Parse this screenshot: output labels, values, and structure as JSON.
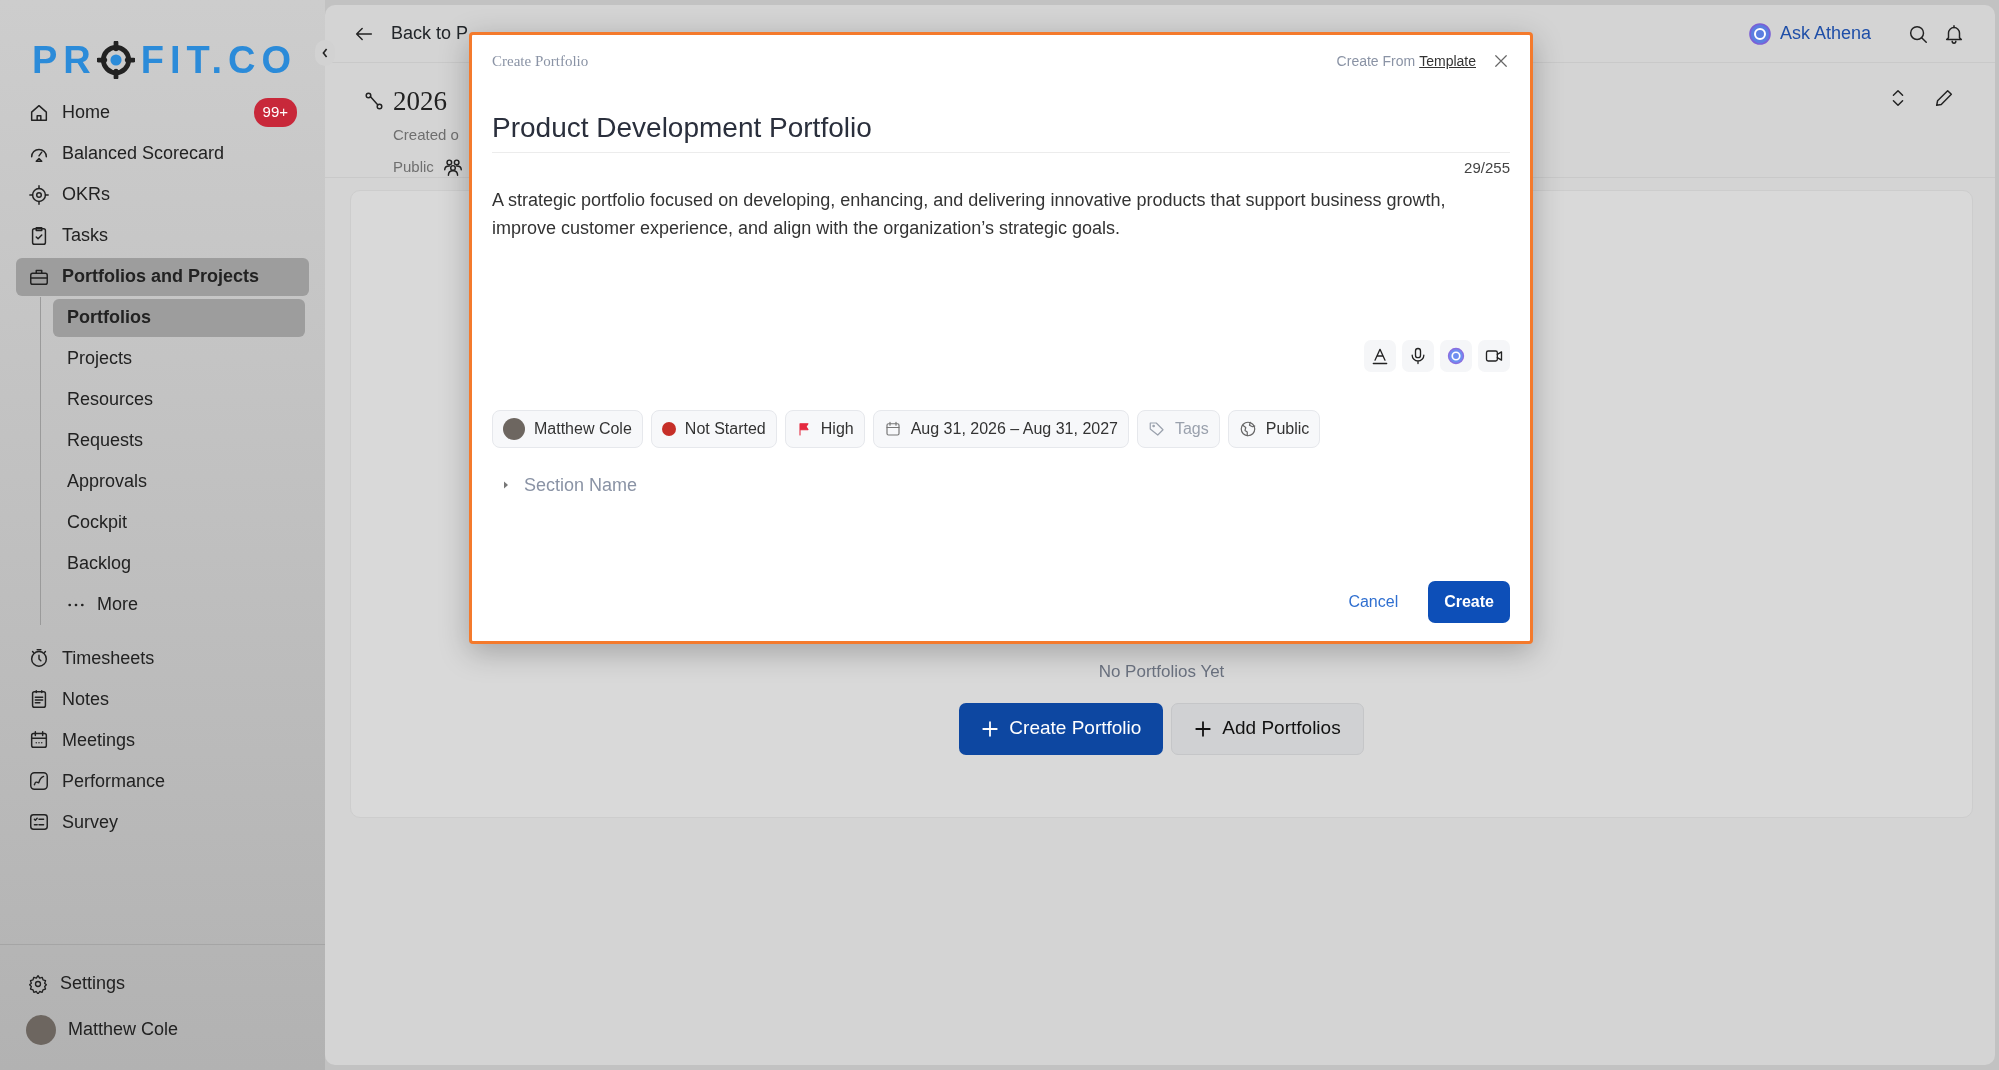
{
  "logo": {
    "before": "PR",
    "after": "FIT.CO"
  },
  "sidebar": {
    "items": [
      {
        "label": "Home",
        "badge": "99+",
        "selected": false
      },
      {
        "label": "Balanced Scorecard",
        "selected": false
      },
      {
        "label": "OKRs",
        "selected": false
      },
      {
        "label": "Tasks",
        "selected": false
      },
      {
        "label": "Portfolios and Projects",
        "selected": true,
        "children": [
          {
            "label": "Portfolios",
            "selected": true
          },
          {
            "label": "Projects",
            "selected": false
          },
          {
            "label": "Resources",
            "selected": false
          },
          {
            "label": "Requests",
            "selected": false
          },
          {
            "label": "Approvals",
            "selected": false
          },
          {
            "label": "Cockpit",
            "selected": false
          },
          {
            "label": "Backlog",
            "selected": false
          },
          {
            "label": "More",
            "kind": "more",
            "selected": false
          }
        ]
      },
      {
        "label": "Timesheets",
        "selected": false
      },
      {
        "label": "Notes",
        "selected": false
      },
      {
        "label": "Meetings",
        "selected": false
      },
      {
        "label": "Performance",
        "selected": false
      },
      {
        "label": "Survey",
        "selected": false
      }
    ],
    "settings": "Settings",
    "user": "Matthew Cole"
  },
  "topbar": {
    "back": "Back to P",
    "assistant": "Ask Athena"
  },
  "page": {
    "title": "2026",
    "meta": "Created o",
    "visibility": "Public"
  },
  "empty_state": {
    "message": "No Portfolios Yet",
    "buttons": [
      {
        "label": "Create Portfolio",
        "kind": "primary"
      },
      {
        "label": "Add Portfolios",
        "kind": "secondary"
      }
    ]
  },
  "modal": {
    "header": "Create Portfolio",
    "create_from": "Create From",
    "template_link": "Template",
    "title_value": "Product Development Portfolio",
    "counter": "29/255",
    "description": "A strategic portfolio focused on developing, enhancing, and delivering innovative products that support business growth, improve customer experience, and align with the organization’s strategic goals.",
    "chips": [
      {
        "kind": "owner",
        "label": "Matthew Cole"
      },
      {
        "kind": "status",
        "label": "Not Started",
        "color": "#c62f28"
      },
      {
        "kind": "priority",
        "label": "High"
      },
      {
        "kind": "date",
        "label": "Aug 31, 2026 – Aug 31, 2027"
      },
      {
        "kind": "tags",
        "label": "Tags"
      },
      {
        "kind": "visibility",
        "label": "Public"
      }
    ],
    "section": {
      "label": "Section Name",
      "expanded": false
    },
    "cancel": "Cancel",
    "create": "Create"
  }
}
